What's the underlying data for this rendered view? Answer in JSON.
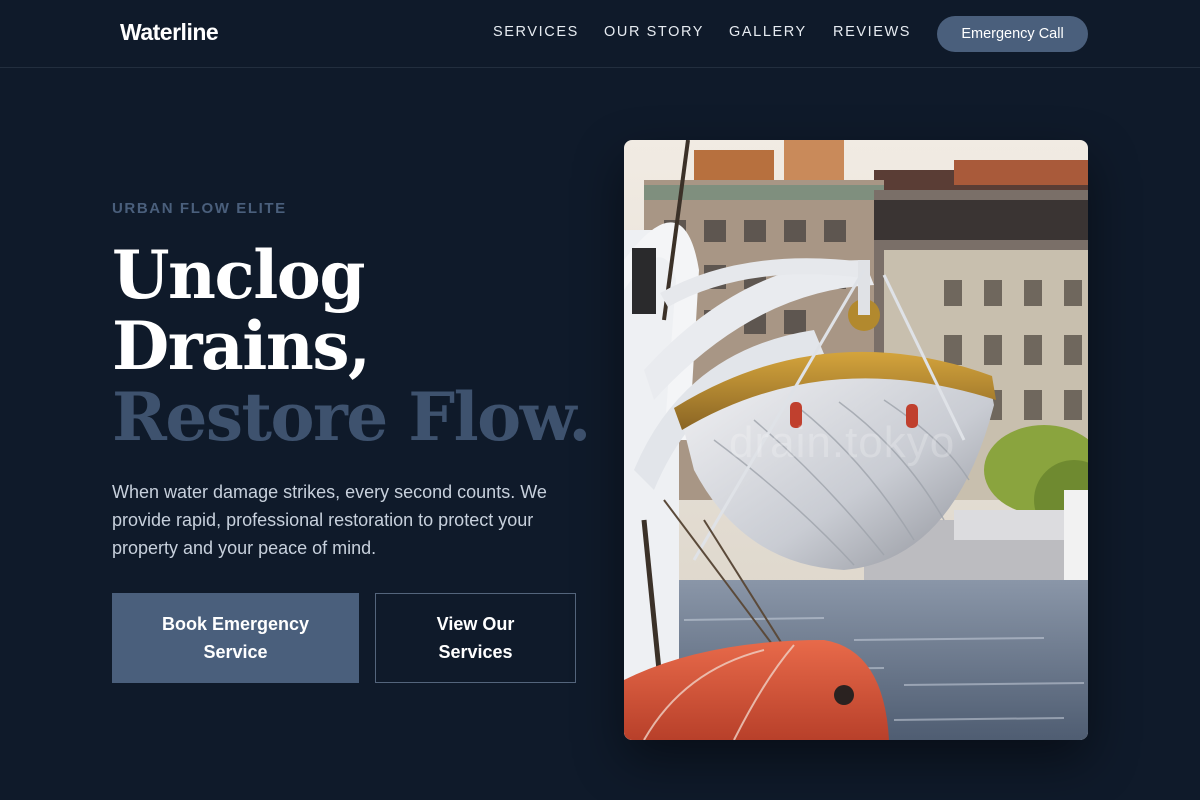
{
  "header": {
    "logo": "Waterline",
    "nav": [
      "SERVICES",
      "OUR STORY",
      "GALLERY",
      "REVIEWS"
    ],
    "cta": "Emergency Call"
  },
  "hero": {
    "eyebrow": "URBAN FLOW ELITE",
    "headline": [
      "Unclog",
      "Drains,",
      "Restore Flow."
    ],
    "lede": "When water damage strikes, every second counts. We provide rapid, professional restoration to protect your property and your peace of mind.",
    "primary_button": "Book Emergency Service",
    "secondary_button": "View Our Services",
    "image_watermark": "drain.tokyo"
  },
  "colors": {
    "background": "#0f1a2a",
    "accent": "#4a5f7c",
    "headline_accent": "#3e526e"
  }
}
